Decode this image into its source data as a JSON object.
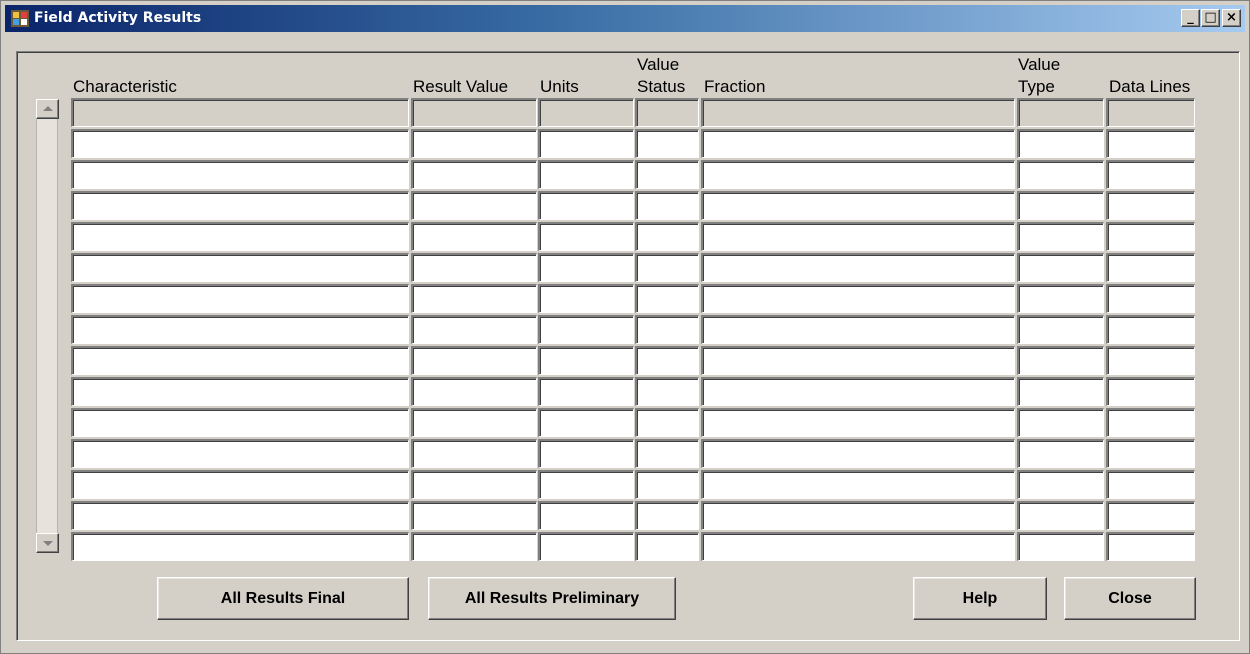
{
  "window": {
    "title": "Field Activity Results",
    "app_icon": "oracle-forms-app-icon",
    "controls": {
      "minimize": "_",
      "maximize": "□",
      "close": "×"
    }
  },
  "grid": {
    "columns": [
      {
        "key": "characteristic",
        "label": "Characteristic"
      },
      {
        "key": "result_value",
        "label": "Result Value"
      },
      {
        "key": "units",
        "label": "Units"
      },
      {
        "key": "value_status",
        "label_top": "Value",
        "label": "Status"
      },
      {
        "key": "fraction",
        "label": "Fraction"
      },
      {
        "key": "value_type",
        "label_top": "Value",
        "label": "Type"
      },
      {
        "key": "data_lines",
        "label": "Data Lines"
      }
    ],
    "rows": [
      [
        "",
        "",
        "",
        "",
        "",
        "",
        ""
      ],
      [
        "",
        "",
        "",
        "",
        "",
        "",
        ""
      ],
      [
        "",
        "",
        "",
        "",
        "",
        "",
        ""
      ],
      [
        "",
        "",
        "",
        "",
        "",
        "",
        ""
      ],
      [
        "",
        "",
        "",
        "",
        "",
        "",
        ""
      ],
      [
        "",
        "",
        "",
        "",
        "",
        "",
        ""
      ],
      [
        "",
        "",
        "",
        "",
        "",
        "",
        ""
      ],
      [
        "",
        "",
        "",
        "",
        "",
        "",
        ""
      ],
      [
        "",
        "",
        "",
        "",
        "",
        "",
        ""
      ],
      [
        "",
        "",
        "",
        "",
        "",
        "",
        ""
      ],
      [
        "",
        "",
        "",
        "",
        "",
        "",
        ""
      ],
      [
        "",
        "",
        "",
        "",
        "",
        "",
        ""
      ],
      [
        "",
        "",
        "",
        "",
        "",
        "",
        ""
      ],
      [
        "",
        "",
        "",
        "",
        "",
        "",
        ""
      ],
      [
        "",
        "",
        "",
        "",
        "",
        "",
        ""
      ]
    ]
  },
  "buttons": {
    "all_final": "All Results Final",
    "all_preliminary": "All Results Preliminary",
    "help": "Help",
    "close": "Close"
  },
  "icons": {
    "scroll_up": "scroll-up-arrow-icon",
    "scroll_down": "scroll-down-arrow-icon"
  },
  "colors": {
    "titlebar_start": "#0a246a",
    "titlebar_end": "#a6caf0",
    "face": "#d4d0c8"
  }
}
